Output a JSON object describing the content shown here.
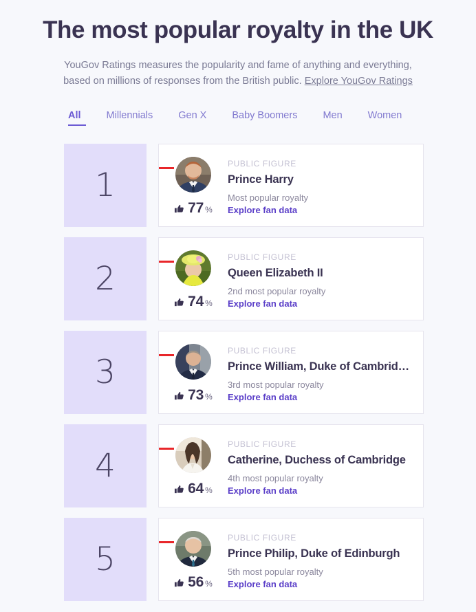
{
  "header": {
    "title": "The most popular royalty in the UK",
    "subtitle_text": "YouGov Ratings measures the popularity and fame of anything and everything, based on millions of responses from the British public. ",
    "subtitle_link": "Explore YouGov Ratings"
  },
  "tabs": [
    {
      "label": "All",
      "active": true
    },
    {
      "label": "Millennials",
      "active": false
    },
    {
      "label": "Gen X",
      "active": false
    },
    {
      "label": "Baby Boomers",
      "active": false
    },
    {
      "label": "Men",
      "active": false
    },
    {
      "label": "Women",
      "active": false
    }
  ],
  "theme": {
    "page_background": "#f7f8fc",
    "rank_box": "#e2ddfa",
    "accent_purple": "#5a3ec8",
    "tab_purple": "#6c5bd4",
    "marker_red": "#e8262a",
    "card_border": "#e6e4ee",
    "heading": "#3a3352"
  },
  "labels": {
    "kicker": "PUBLIC FIGURE",
    "percent_symbol": "%",
    "explore_link": "Explore fan data"
  },
  "rankings": [
    {
      "rank": "1",
      "kicker": "PUBLIC FIGURE",
      "name": "Prince Harry",
      "score": "77",
      "percent": "%",
      "caption": "Most popular royalty",
      "link": "Explore fan data",
      "avatar_icon": "portrait-prince-harry"
    },
    {
      "rank": "2",
      "kicker": "PUBLIC FIGURE",
      "name": "Queen Elizabeth II",
      "score": "74",
      "percent": "%",
      "caption": "2nd most popular royalty",
      "link": "Explore fan data",
      "avatar_icon": "portrait-queen-elizabeth-ii"
    },
    {
      "rank": "3",
      "kicker": "PUBLIC FIGURE",
      "name": "Prince William, Duke of Cambrid…",
      "score": "73",
      "percent": "%",
      "caption": "3rd most popular royalty",
      "link": "Explore fan data",
      "avatar_icon": "portrait-prince-william"
    },
    {
      "rank": "4",
      "kicker": "PUBLIC FIGURE",
      "name": "Catherine, Duchess of Cambridge",
      "score": "64",
      "percent": "%",
      "caption": "4th most popular royalty",
      "link": "Explore fan data",
      "avatar_icon": "portrait-catherine-duchess"
    },
    {
      "rank": "5",
      "kicker": "PUBLIC FIGURE",
      "name": "Prince Philip, Duke of Edinburgh",
      "score": "56",
      "percent": "%",
      "caption": "5th most popular royalty",
      "link": "Explore fan data",
      "avatar_icon": "portrait-prince-philip"
    }
  ]
}
